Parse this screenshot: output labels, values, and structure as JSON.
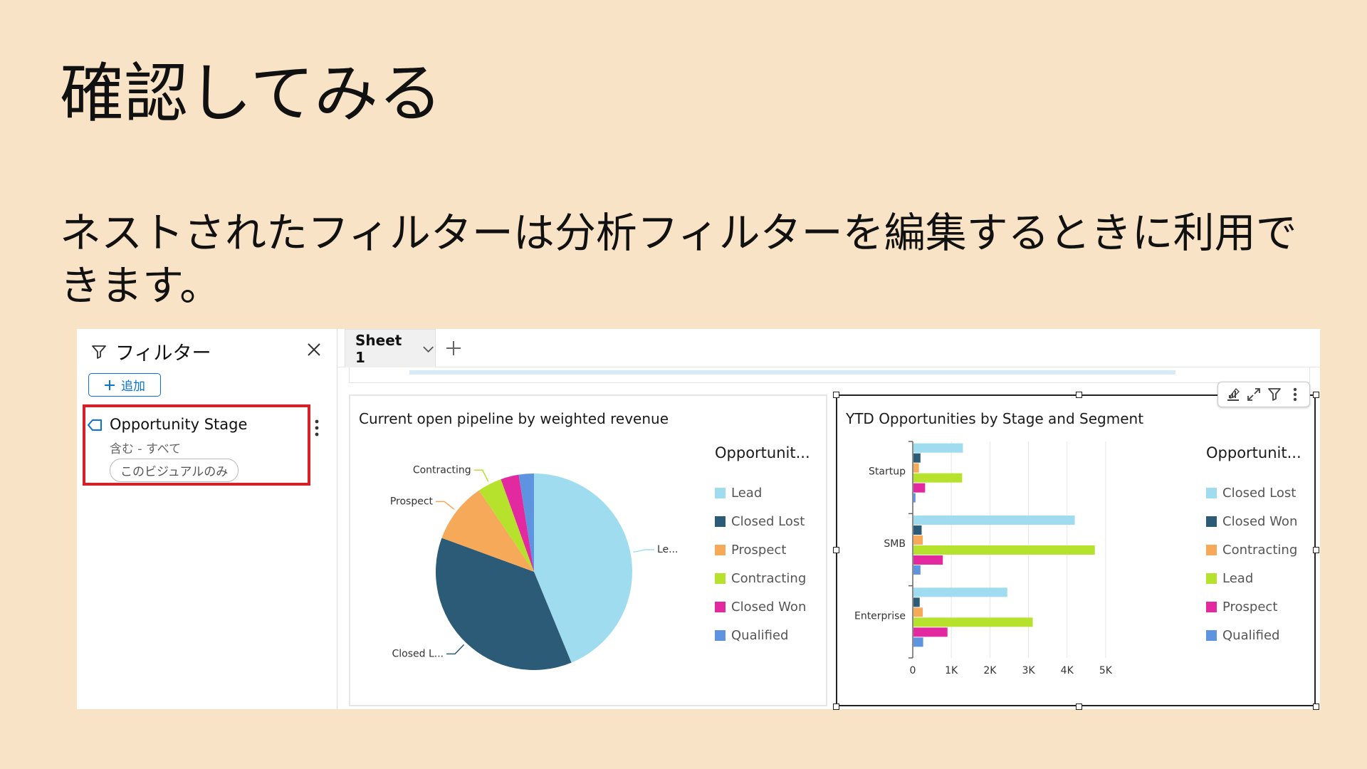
{
  "slide": {
    "title": "確認してみる",
    "body": "ネストされたフィルターは分析フィルターを編集するときに利用できます。"
  },
  "filter_panel": {
    "title": "フィルター",
    "add_label": "追加",
    "item": {
      "name": "Opportunity Stage",
      "condition": "含む - すべて",
      "scope": "このビジュアルのみ"
    }
  },
  "tabs": {
    "sheet_label": "Sheet 1"
  },
  "colors": {
    "light_blue": "#9fdcf0",
    "dark_blue": "#2b5b76",
    "orange": "#f5a959",
    "lime": "#b6e22e",
    "magenta": "#e2299f",
    "blue": "#5e93e0",
    "highlight_red": "#d62027"
  },
  "chart_data": [
    {
      "type": "pie",
      "title": "Current open pipeline by weighted revenue",
      "legend_title": "Opportunit...",
      "legend_position": "right",
      "legend": [
        "Lead",
        "Closed Lost",
        "Prospect",
        "Contracting",
        "Closed Won",
        "Qualified"
      ],
      "slices": [
        {
          "name": "Lead",
          "value": 44,
          "color": "#9fdcf0",
          "label": "Le..."
        },
        {
          "name": "Closed Lost",
          "value": 37,
          "color": "#2b5b76",
          "label": "Closed L..."
        },
        {
          "name": "Prospect",
          "value": 10,
          "color": "#f5a959",
          "label": "Prospect"
        },
        {
          "name": "Contracting",
          "value": 4,
          "color": "#b6e22e",
          "label": "Contracting"
        },
        {
          "name": "Closed Won",
          "value": 3,
          "color": "#e2299f",
          "label": ""
        },
        {
          "name": "Qualified",
          "value": 2.5,
          "color": "#5e93e0",
          "label": ""
        }
      ]
    },
    {
      "type": "bar",
      "orientation": "horizontal",
      "title": "YTD Opportunities by Stage and Segment",
      "legend_title": "Opportunit...",
      "legend_position": "right",
      "categories": [
        "Startup",
        "SMB",
        "Enterprise"
      ],
      "xlim": [
        0,
        5500
      ],
      "xticks": [
        0,
        1000,
        2000,
        3000,
        4000,
        5000
      ],
      "xtick_labels": [
        "0",
        "1K",
        "2K",
        "3K",
        "4K",
        "5K"
      ],
      "grid": true,
      "series": [
        {
          "name": "Closed Lost",
          "color": "#9fdcf0",
          "values": [
            1300,
            4200,
            2450
          ]
        },
        {
          "name": "Closed Won",
          "color": "#2b5b76",
          "values": [
            200,
            230,
            180
          ]
        },
        {
          "name": "Contracting",
          "color": "#f5a959",
          "values": [
            160,
            260,
            260
          ]
        },
        {
          "name": "Lead",
          "color": "#b6e22e",
          "values": [
            1280,
            4720,
            3110
          ]
        },
        {
          "name": "Prospect",
          "color": "#e2299f",
          "values": [
            320,
            780,
            900
          ]
        },
        {
          "name": "Qualified",
          "color": "#5e93e0",
          "values": [
            70,
            200,
            270
          ]
        }
      ]
    }
  ]
}
